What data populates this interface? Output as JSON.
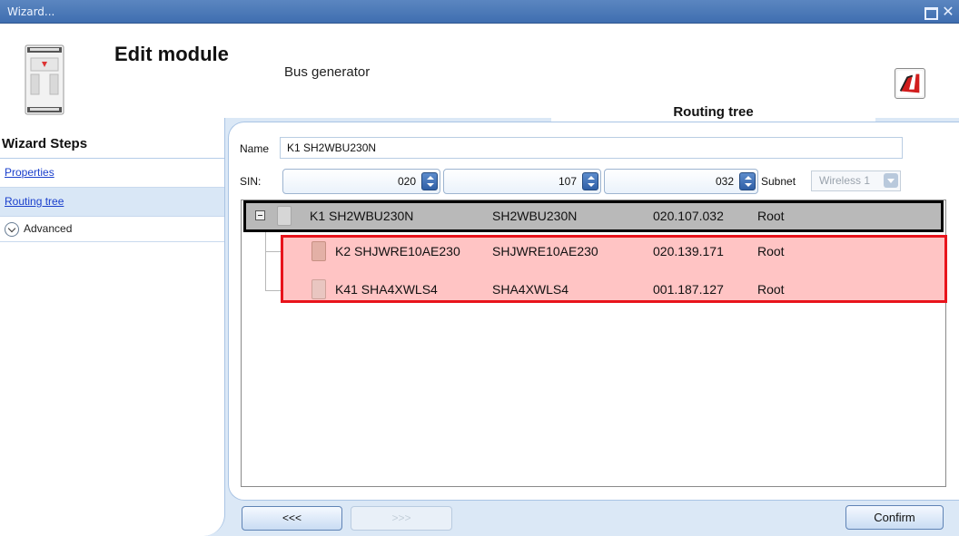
{
  "window": {
    "title": "Wizard..."
  },
  "header": {
    "title": "Edit module",
    "subtitle": "Bus generator"
  },
  "sidebar": {
    "title": "Wizard Steps",
    "steps": [
      {
        "label": "Properties",
        "active": false
      },
      {
        "label": "Routing tree",
        "active": true
      }
    ],
    "advanced_label": "Advanced"
  },
  "tab": {
    "label": "Routing tree"
  },
  "form": {
    "name_label": "Name",
    "name_value": "K1 SH2WBU230N",
    "sin_label": "SIN:",
    "sin": [
      "020",
      "107",
      "032"
    ],
    "subnet_label": "Subnet",
    "subnet_value": "Wireless 1"
  },
  "tree": {
    "rows": [
      {
        "name": "K1 SH2WBU230N",
        "model": "SH2WBU230N",
        "address": "020.107.032",
        "route": "Root",
        "level": 0
      },
      {
        "name": "K2 SHJWRE10AE230",
        "model": "SHJWRE10AE230",
        "address": "020.139.171",
        "route": "Root",
        "level": 1
      },
      {
        "name": "K41 SHA4XWLS4",
        "model": "SHA4XWLS4",
        "address": "001.187.127",
        "route": "Root",
        "level": 1
      }
    ]
  },
  "footer": {
    "back_label": "<<<",
    "next_label": ">>>",
    "confirm_label": "Confirm"
  },
  "colors": {
    "highlight_fill": "#ffc4c4",
    "highlight_border": "#e8141c",
    "selected_row": "#b9b9b9",
    "accent": "#3f6eb0"
  }
}
